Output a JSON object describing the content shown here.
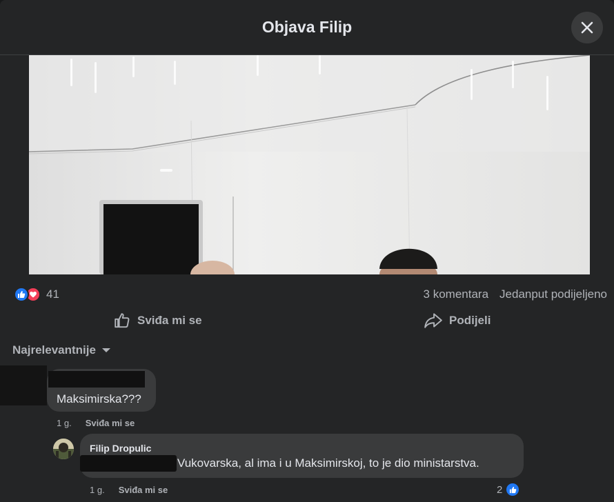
{
  "modal": {
    "title": "Objava Filip",
    "close_icon": "close-icon"
  },
  "post": {
    "reactions": {
      "icons": [
        "like-icon",
        "love-icon"
      ],
      "count": "41"
    },
    "comments_count": "3 komentara",
    "shares_text": "Jedanput podijeljeno",
    "actions": {
      "like_label": "Sviđa mi se",
      "share_label": "Podijeli"
    }
  },
  "comments_section": {
    "sort_label": "Najrelevantnije",
    "comments": [
      {
        "author": "",
        "text": "Maksimirska???",
        "time": "1 g.",
        "like_label": "Sviđa mi se"
      },
      {
        "author": "Filip Dropulic",
        "text": "Vukovarska, al ima i u Maksimirskoj, to je dio ministarstva.",
        "time": "1 g.",
        "like_label": "Sviđa mi se",
        "likes": "2"
      }
    ]
  },
  "colors": {
    "modal_bg": "#242526",
    "bubble_bg": "#3a3b3c",
    "text_primary": "#e4e6eb",
    "text_secondary": "#b0b3b8",
    "like_blue": "#2078f4",
    "love_red": "#f33e58"
  }
}
